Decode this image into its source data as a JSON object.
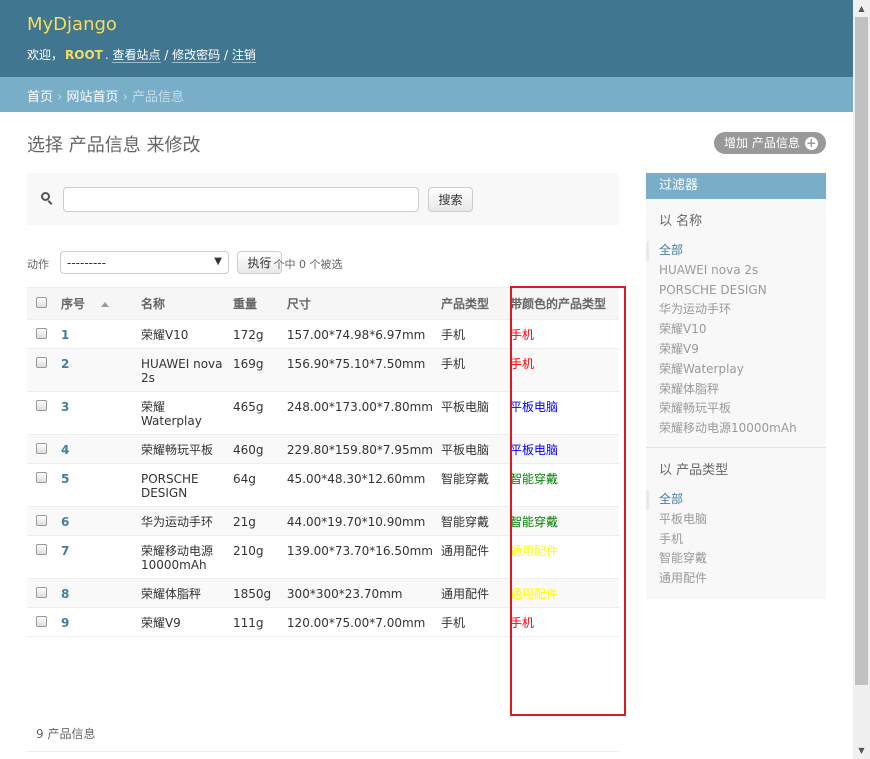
{
  "header": {
    "site_name": "MyDjango",
    "welcome": "欢迎，",
    "username": "ROOT",
    "view_site": "查看站点",
    "change_password": "修改密码",
    "logout": "注销",
    "sep": " / "
  },
  "breadcrumbs": {
    "home": "首页",
    "app": "网站首页",
    "current": "产品信息",
    "sep": " › "
  },
  "page": {
    "title": "选择 产品信息 来修改",
    "add_label": "增加 产品信息"
  },
  "search": {
    "value": "",
    "button": "搜索"
  },
  "actions": {
    "label": "动作",
    "selected": "---------",
    "go": "执行",
    "counter": "9 个中 0 个被选"
  },
  "table": {
    "columns": [
      "序号",
      "名称",
      "重量",
      "尺寸",
      "产品类型",
      "带颜色的产品类型"
    ],
    "rows": [
      {
        "id": "1",
        "name": "荣耀V10",
        "weight": "172g",
        "size": "157.00*74.98*6.97mm",
        "type": "手机",
        "colored_type": "手机",
        "color": "#ff0000"
      },
      {
        "id": "2",
        "name": "HUAWEI nova 2s",
        "weight": "169g",
        "size": "156.90*75.10*7.50mm",
        "type": "手机",
        "colored_type": "手机",
        "color": "#ff0000"
      },
      {
        "id": "3",
        "name": "荣耀 Waterplay",
        "weight": "465g",
        "size": "248.00*173.00*7.80mm",
        "type": "平板电脑",
        "colored_type": "平板电脑",
        "color": "#0000ff"
      },
      {
        "id": "4",
        "name": "荣耀畅玩平板",
        "weight": "460g",
        "size": "229.80*159.80*7.95mm",
        "type": "平板电脑",
        "colored_type": "平板电脑",
        "color": "#0000ff"
      },
      {
        "id": "5",
        "name": "PORSCHE DESIGN",
        "weight": "64g",
        "size": "45.00*48.30*12.60mm",
        "type": "智能穿戴",
        "colored_type": "智能穿戴",
        "color": "#008000"
      },
      {
        "id": "6",
        "name": "华为运动手环",
        "weight": "21g",
        "size": "44.00*19.70*10.90mm",
        "type": "智能穿戴",
        "colored_type": "智能穿戴",
        "color": "#008000"
      },
      {
        "id": "7",
        "name": "荣耀移动电源10000mAh",
        "weight": "210g",
        "size": "139.00*73.70*16.50mm",
        "type": "通用配件",
        "colored_type": "通用配件",
        "color": "#ffff00"
      },
      {
        "id": "8",
        "name": "荣耀体脂秤",
        "weight": "1850g",
        "size": "300*300*23.70mm",
        "type": "通用配件",
        "colored_type": "通用配件",
        "color": "#ffff00"
      },
      {
        "id": "9",
        "name": "荣耀V9",
        "weight": "111g",
        "size": "120.00*75.00*7.00mm",
        "type": "手机",
        "colored_type": "手机",
        "color": "#ff0000"
      }
    ]
  },
  "paginator": "9 产品信息",
  "filter": {
    "title": "过滤器",
    "groups": [
      {
        "heading": "以 名称",
        "items": [
          "全部",
          "HUAWEI nova 2s",
          "PORSCHE DESIGN",
          "华为运动手环",
          "荣耀V10",
          "荣耀V9",
          "荣耀Waterplay",
          "荣耀体脂秤",
          "荣耀畅玩平板",
          "荣耀移动电源10000mAh"
        ]
      },
      {
        "heading": "以 产品类型",
        "items": [
          "全部",
          "平板电脑",
          "手机",
          "智能穿戴",
          "通用配件"
        ]
      }
    ]
  }
}
